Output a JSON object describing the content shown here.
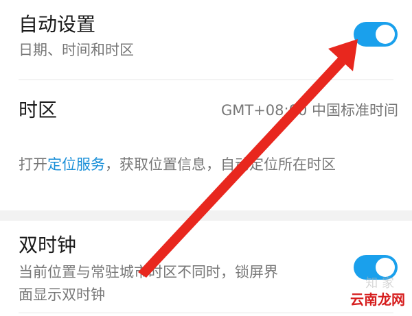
{
  "auto": {
    "title": "自动设置",
    "subtitle": "日期、时间和时区",
    "toggle_on": true
  },
  "timezone": {
    "title": "时区",
    "value": "GMT+08:00 中国标准时间"
  },
  "hint": {
    "prefix": "打开",
    "link": "定位服务",
    "suffix": "，获取位置信息，自动定位所在时区"
  },
  "dual_clock": {
    "title": "双时钟",
    "subtitle_line1": "当前位置与常驻城市时区不同时，锁屏界",
    "subtitle_line2": "面显示双时钟",
    "toggle_on": true
  },
  "watermark": {
    "text": "云南龙网",
    "faint_text": "知   家"
  },
  "colors": {
    "accent": "#1aa0ec",
    "link": "#1a8fd8",
    "arrow": "#e8271e",
    "watermark": "#d61d1d"
  }
}
